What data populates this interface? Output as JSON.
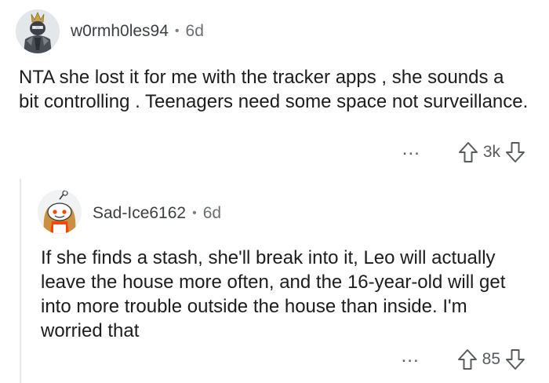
{
  "comments": [
    {
      "username": "w0rmh0les94",
      "separator": "•",
      "age": "6d",
      "avatar_icon": "armored-character-avatar",
      "body": "NTA she lost it for me with the tracker apps , she sounds a bit controlling . Teenagers need some space not surveillance.",
      "more_label": "...",
      "votes": "3k"
    },
    {
      "username": "Sad-Ice6162",
      "separator": "•",
      "age": "6d",
      "avatar_icon": "reddit-snoo-avatar",
      "body": "If she finds a stash, she'll break into it, Leo will actually leave the house more often, and the 16-year-old will get into more trouble outside the house than inside. I'm worried that",
      "more_label": "...",
      "votes": "85"
    }
  ],
  "colors": {
    "text": "#1c1c1c",
    "meta": "#6b6e71",
    "thread_line": "#e6e7e8"
  }
}
